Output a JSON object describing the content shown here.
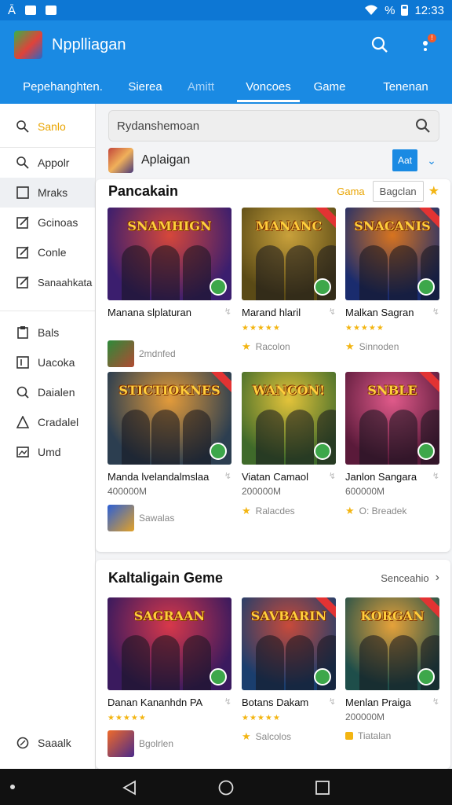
{
  "status_bar": {
    "left_text": "Ā",
    "time": "12:33",
    "signal_text": "%"
  },
  "app": {
    "title": "Npplliagan"
  },
  "tabs": [
    {
      "label": "Pepehanghten.",
      "state": "normal"
    },
    {
      "label": "Sierea",
      "state": "normal"
    },
    {
      "label": "Amitt",
      "state": "dim"
    },
    {
      "label": "Voncoes",
      "state": "active"
    },
    {
      "label": "Game",
      "state": "normal"
    },
    {
      "label": "Tenenan",
      "state": "normal"
    }
  ],
  "sidebar": {
    "items": [
      {
        "label": "Sanlo",
        "icon": "search-icon"
      },
      {
        "label": "Appolr",
        "icon": "search-icon"
      },
      {
        "label": "Mraks",
        "icon": "square-icon"
      },
      {
        "label": "Gcinoas",
        "icon": "edit-icon"
      },
      {
        "label": "Conle",
        "icon": "edit-icon"
      },
      {
        "label": "Sanaahkata",
        "icon": "edit-icon"
      },
      {
        "label": "Bals",
        "icon": "clipboard-icon"
      },
      {
        "label": "Uacoka",
        "icon": "square-icon"
      },
      {
        "label": "Daialen",
        "icon": "search-icon"
      },
      {
        "label": "Cradalel",
        "icon": "triangle-icon"
      },
      {
        "label": "Umd",
        "icon": "image-icon"
      }
    ],
    "footer_label": "Saaalk"
  },
  "search": {
    "placeholder": "Rydanshemoan"
  },
  "app_row": {
    "name": "Aplaigan",
    "add_label": "Aat"
  },
  "section1": {
    "title": "Pancakain",
    "game_label": "Gama",
    "button_label": "Bagclan",
    "tiles": [
      {
        "thumb_title": "SNAMHIGN",
        "name": "Manana slplaturan",
        "sub": "",
        "foot": "2mdnfed",
        "colors": [
          "#3b1e6e",
          "#d6473a"
        ]
      },
      {
        "thumb_title": "MANANC",
        "name": "Marand hlaril",
        "sub": "★★★★★",
        "foot": "Racolon",
        "colors": [
          "#5a4a16",
          "#c9a13b"
        ]
      },
      {
        "thumb_title": "SNACANIS",
        "name": "Malkan Sagran",
        "sub": "★★★★★",
        "foot": "Sinnoden",
        "colors": [
          "#1a2c6e",
          "#d8741f"
        ]
      },
      {
        "thumb_title": "STICTIOKNES",
        "name": "Manda lvelandalmslaa",
        "sub": "400000M",
        "foot": "Sawalas",
        "colors": [
          "#2c3e50",
          "#e39b3a"
        ]
      },
      {
        "thumb_title": "WANCON!",
        "name": "Viatan Camaol",
        "sub": "200000M",
        "foot": "Ralacdes",
        "colors": [
          "#3f6a2a",
          "#e3c33a"
        ]
      },
      {
        "thumb_title": "SNBLE",
        "name": "Janlon Sangara",
        "sub": "600000M",
        "foot": "O: Breadek",
        "colors": [
          "#5a1a3a",
          "#e05a8a"
        ]
      }
    ]
  },
  "section2": {
    "title": "Kaltaligain Geme",
    "link_label": "Senceahio",
    "tiles": [
      {
        "thumb_title": "SAGRAAN",
        "name": "Danan Kananhdn PA",
        "sub": "★★★★★",
        "foot": "Bgolrlen",
        "colors": [
          "#3a1a5e",
          "#d8384a"
        ]
      },
      {
        "thumb_title": "SAVBARIN",
        "name": "Botans Dakam",
        "sub": "★★★★★",
        "foot": "Salcolos",
        "colors": [
          "#1a3e6e",
          "#c84a3a"
        ]
      },
      {
        "thumb_title": "KORGAN",
        "name": "Menlan Praiga",
        "sub": "200000M",
        "foot": "Tiatalan",
        "colors": [
          "#1e4e4a",
          "#e6a23a"
        ]
      }
    ]
  }
}
